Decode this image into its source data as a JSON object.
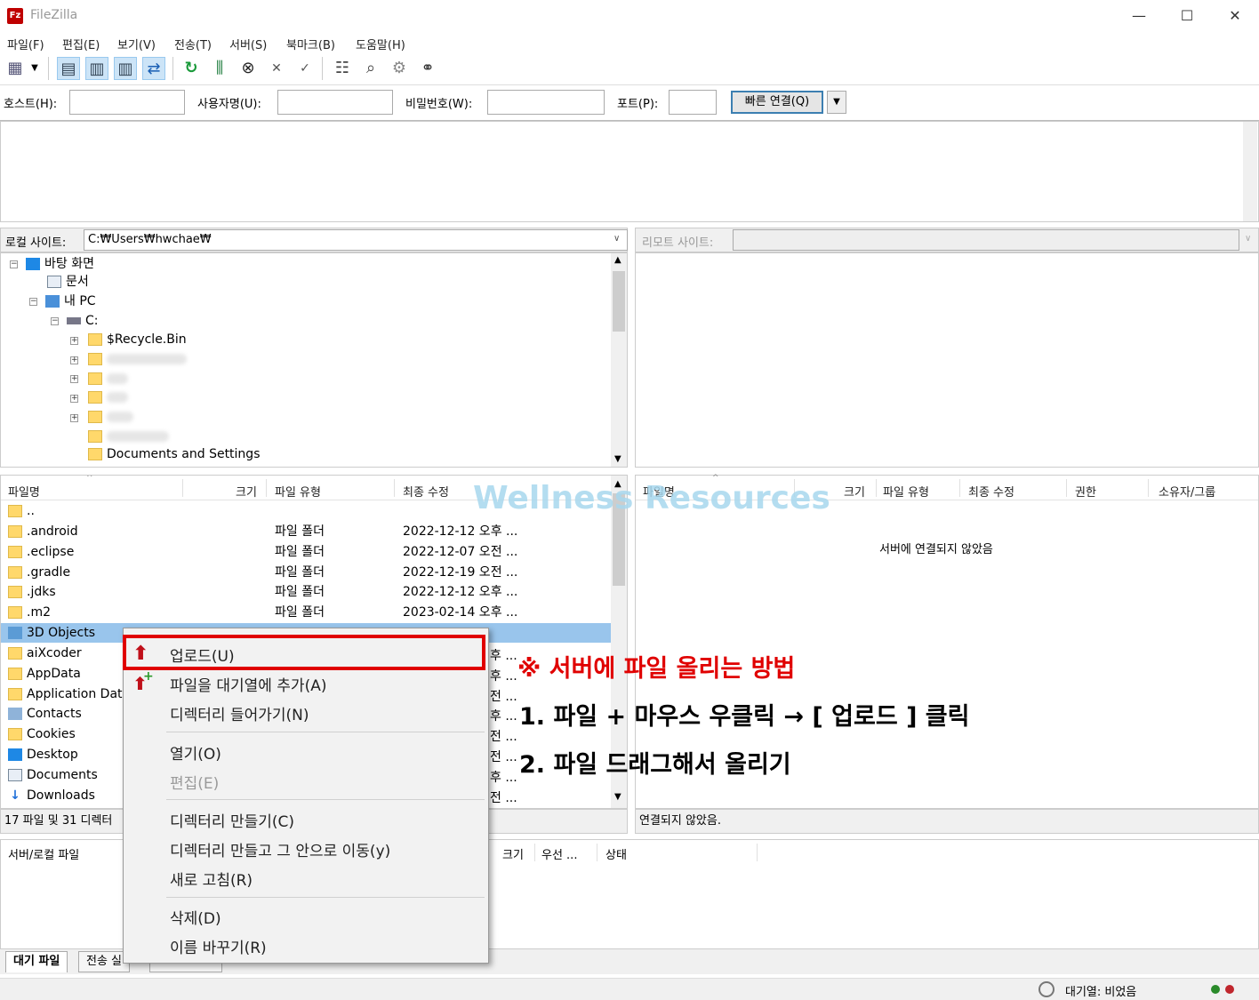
{
  "app": {
    "title": "FileZilla",
    "icon_letter": "Fz"
  },
  "window": {
    "minimize": "—",
    "maximize": "☐",
    "close": "✕"
  },
  "menu": [
    "파일(F)",
    "편집(E)",
    "보기(V)",
    "전송(T)",
    "서버(S)",
    "북마크(B)",
    "도움말(H)"
  ],
  "quickconnect": {
    "host_label": "호스트(H):",
    "user_label": "사용자명(U):",
    "pass_label": "비밀번호(W):",
    "port_label": "포트(P):",
    "connect_button": "빠른 연결(Q)",
    "host_value": "",
    "user_value": "",
    "pass_value": "",
    "port_value": ""
  },
  "local": {
    "site_label": "로컬 사이트:",
    "path": "C:₩Users₩hwchae₩",
    "tree": {
      "desktop": "바탕 화면",
      "documents": "문서",
      "mypc": "내 PC",
      "c_drive": "C:",
      "recycle": "$Recycle.Bin",
      "docs_settings": "Documents and Settings"
    },
    "headers": {
      "name": "파일명",
      "size": "크기",
      "type": "파일 유형",
      "modified": "최종 수정"
    },
    "files": [
      {
        "name": "..",
        "type": "",
        "date": ""
      },
      {
        "name": ".android",
        "type": "파일 폴더",
        "date": "2022-12-12 오후 ..."
      },
      {
        "name": ".eclipse",
        "type": "파일 폴더",
        "date": "2022-12-07 오전 ..."
      },
      {
        "name": ".gradle",
        "type": "파일 폴더",
        "date": "2022-12-19 오전 ..."
      },
      {
        "name": ".jdks",
        "type": "파일 폴더",
        "date": "2022-12-12 오후 ..."
      },
      {
        "name": ".m2",
        "type": "파일 폴더",
        "date": "2023-02-14 오후 ..."
      },
      {
        "name": "3D Objects",
        "type": "",
        "date": ""
      },
      {
        "name": "aiXcoder",
        "type": "",
        "date": ""
      },
      {
        "name": "AppData",
        "type": "",
        "date": ""
      },
      {
        "name": "Application Data",
        "type": "",
        "date": ""
      },
      {
        "name": "Contacts",
        "type": "",
        "date": ""
      },
      {
        "name": "Cookies",
        "type": "",
        "date": ""
      },
      {
        "name": "Desktop",
        "type": "",
        "date": ""
      },
      {
        "name": "Documents",
        "type": "",
        "date": ""
      },
      {
        "name": "Downloads",
        "type": "",
        "date": ""
      }
    ],
    "date_tails": [
      "후 ...",
      "후 ...",
      "전 ...",
      "후 ...",
      "전 ...",
      "전 ...",
      "후 ...",
      "전 ..."
    ],
    "status": "17 파일 및 31 디렉터"
  },
  "remote": {
    "site_label": "리모트 사이트:",
    "headers": {
      "name": "파일명",
      "size": "크기",
      "type": "파일 유형",
      "modified": "최종 수정",
      "perm": "권한",
      "owner": "소유자/그룹"
    },
    "empty_message": "서버에 연결되지 않았음",
    "status": "연결되지 않았음."
  },
  "queue": {
    "headers": {
      "file": "서버/로컬 파일",
      "size": "크기",
      "priority": "우선 ...",
      "status": "상태"
    },
    "tabs": [
      "대기 파일",
      "전송 실"
    ]
  },
  "statusbar": {
    "queue_text": "대기열: 비었음"
  },
  "context_menu": {
    "upload": "업로드(U)",
    "add_queue": "파일을 대기열에 추가(A)",
    "enter_dir": "디렉터리 들어가기(N)",
    "open": "열기(O)",
    "edit": "편집(E)",
    "mkdir": "디렉터리 만들기(C)",
    "mkdir_enter": "디렉터리 만들고 그 안으로 이동(y)",
    "refresh": "새로 고침(R)",
    "delete": "삭제(D)",
    "rename": "이름 바꾸기(R)"
  },
  "annotation": {
    "title": "※ 서버에 파일 올리는 방법",
    "step1": "1. 파일 + 마우스 우클릭 → [ 업로드 ] 클릭",
    "step2": "2. 파일 드래그해서 올리기",
    "watermark": "Wellness Resources"
  },
  "colors": {
    "highlight_red": "#e00000",
    "selected_row": "#99c5ec",
    "accent_blue": "#3c7fb1"
  }
}
